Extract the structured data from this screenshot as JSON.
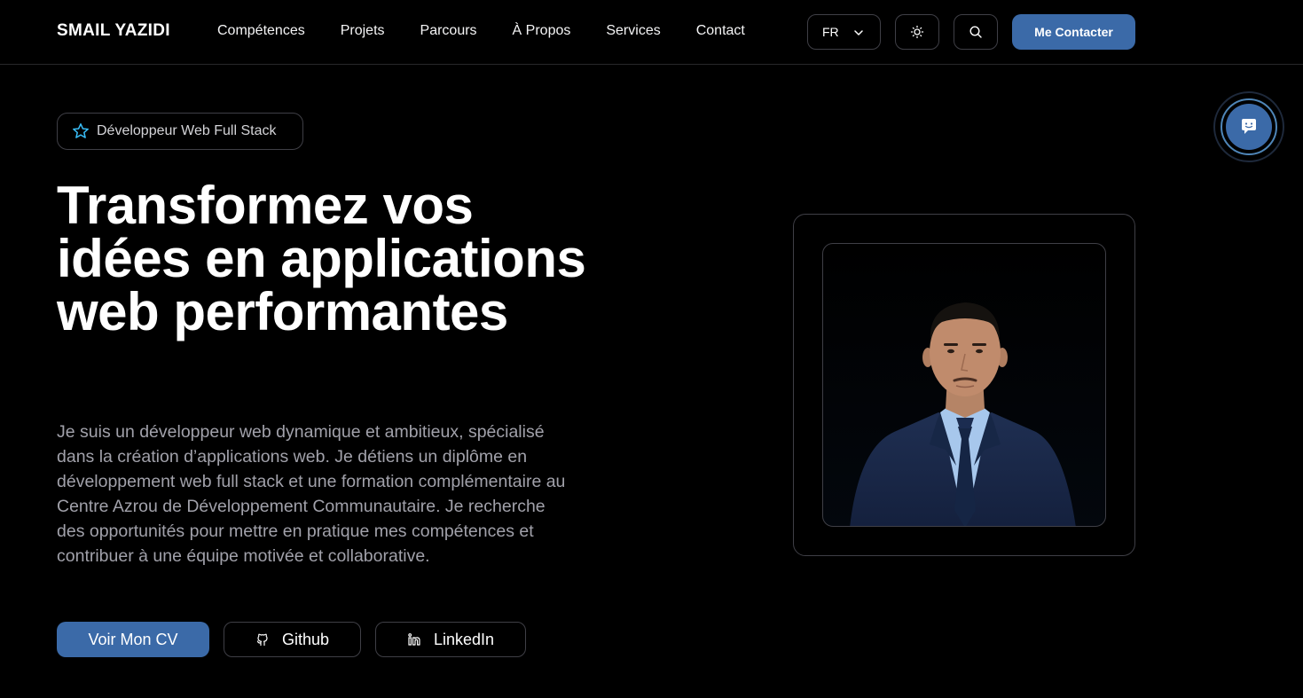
{
  "header": {
    "logo": "SMAIL YAZIDI",
    "nav": [
      "Compétences",
      "Projets",
      "Parcours",
      "À Propos",
      "Services",
      "Contact"
    ],
    "language": "FR",
    "contact_button": "Me Contacter"
  },
  "hero": {
    "badge": "Développeur Web Full Stack",
    "title": "Transformez vos idées en applications web performantes",
    "description": "Je suis un développeur web dynamique et ambitieux, spécialisé dans la création d’applications web. Je détiens un diplôme en développement web full stack et une formation complémentaire au Centre Azrou de Développement Communautaire. Je recherche des opportunités pour mettre en pratique mes compétences et contribuer à une équipe motivée et collaborative.",
    "buttons": {
      "cv": "Voir Mon CV",
      "github": "Github",
      "linkedin": "LinkedIn"
    }
  },
  "icons": {
    "star": "star-icon",
    "chevron": "chevron-down-icon",
    "theme": "sun-icon",
    "search": "search-icon",
    "github": "github-icon",
    "linkedin": "linkedin-icon",
    "chat": "chatbot-icon"
  },
  "colors": {
    "accent": "#3b6aa8",
    "background": "#000000",
    "border": "#3f3f46",
    "muted_text": "#a1a1aa"
  }
}
